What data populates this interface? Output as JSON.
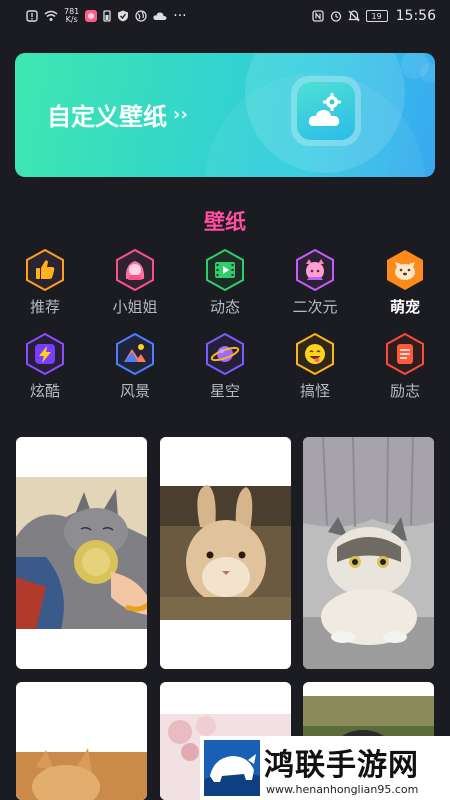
{
  "status_bar": {
    "net_speed_value": "781",
    "net_speed_unit": "K/s",
    "battery": "19",
    "time": "15:56",
    "more": "···"
  },
  "banner": {
    "title": "自定义壁纸",
    "arrow": "››"
  },
  "section": {
    "title": "壁纸"
  },
  "categories": [
    {
      "label": "推荐",
      "icon": "thumbs-up-icon",
      "color": "#ff9f1c"
    },
    {
      "label": "小姐姐",
      "icon": "girl-icon",
      "color": "#ff4f8b"
    },
    {
      "label": "动态",
      "icon": "video-icon",
      "color": "#2ecf6b"
    },
    {
      "label": "二次元",
      "icon": "anime-cat-icon",
      "color": "#c65bff"
    },
    {
      "label": "萌宠",
      "icon": "dog-icon",
      "color": "#ff8a1c",
      "active": true
    },
    {
      "label": "炫酷",
      "icon": "lightning-icon",
      "color": "#8a4dff"
    },
    {
      "label": "风景",
      "icon": "landscape-icon",
      "color": "#4f7dff"
    },
    {
      "label": "星空",
      "icon": "planet-icon",
      "color": "#7a5cff"
    },
    {
      "label": "搞怪",
      "icon": "funny-face-icon",
      "color": "#ffb41c"
    },
    {
      "label": "励志",
      "icon": "note-icon",
      "color": "#ff4a3a"
    }
  ],
  "gallery": [
    {
      "subject": "cat-with-toy",
      "accent": "#8d8d8f"
    },
    {
      "subject": "rabbit",
      "accent": "#c9a27a"
    },
    {
      "subject": "cat-under-curtain",
      "accent": "#9c9c9c"
    },
    {
      "subject": "kitten",
      "accent": "#d79b5a"
    },
    {
      "subject": "pink-flowers",
      "accent": "#e7c2c6"
    },
    {
      "subject": "puppy",
      "accent": "#5b6b3a"
    }
  ],
  "watermark": {
    "title": "鸿联手游网",
    "url": "www.henanhonglian95.com"
  },
  "colors": {
    "background": "#1b1b22",
    "section_title": "#ff4fa0",
    "label": "#b9b9c4"
  }
}
